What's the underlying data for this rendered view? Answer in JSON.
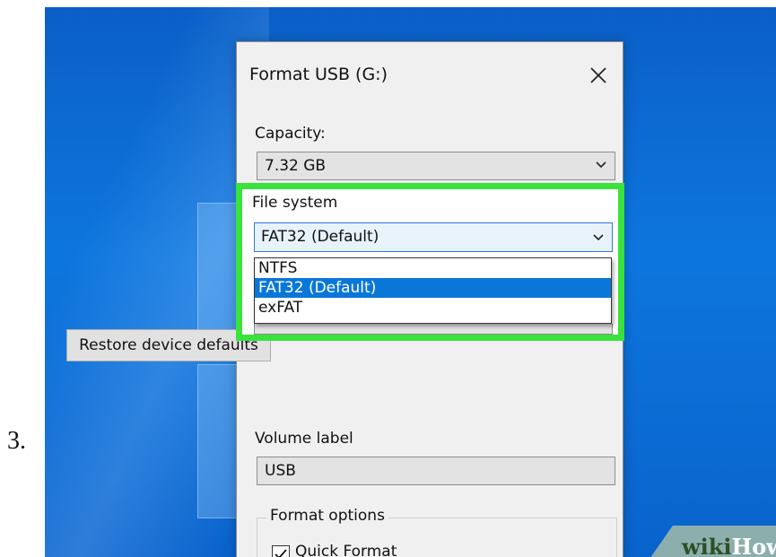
{
  "step_number": "3.",
  "dialog": {
    "title": "Format USB (G:)",
    "capacity": {
      "label": "Capacity:",
      "value": "7.32 GB"
    },
    "file_system": {
      "label": "File system",
      "selected": "FAT32 (Default)",
      "options": [
        "NTFS",
        "FAT32 (Default)",
        "exFAT"
      ],
      "selected_index": 1
    },
    "restore_button": "Restore device defaults",
    "volume_label": {
      "label": "Volume label",
      "value": "USB"
    },
    "format_options": {
      "title": "Format options",
      "quick_format": "Quick Format",
      "quick_format_checked": true
    }
  },
  "watermark": {
    "wiki": "wiki",
    "how": "How"
  },
  "colors": {
    "highlight": "#39e23d",
    "selection": "#0a77d8",
    "desktop": "#0d76de",
    "dialog_bg": "#f0f0f0"
  }
}
